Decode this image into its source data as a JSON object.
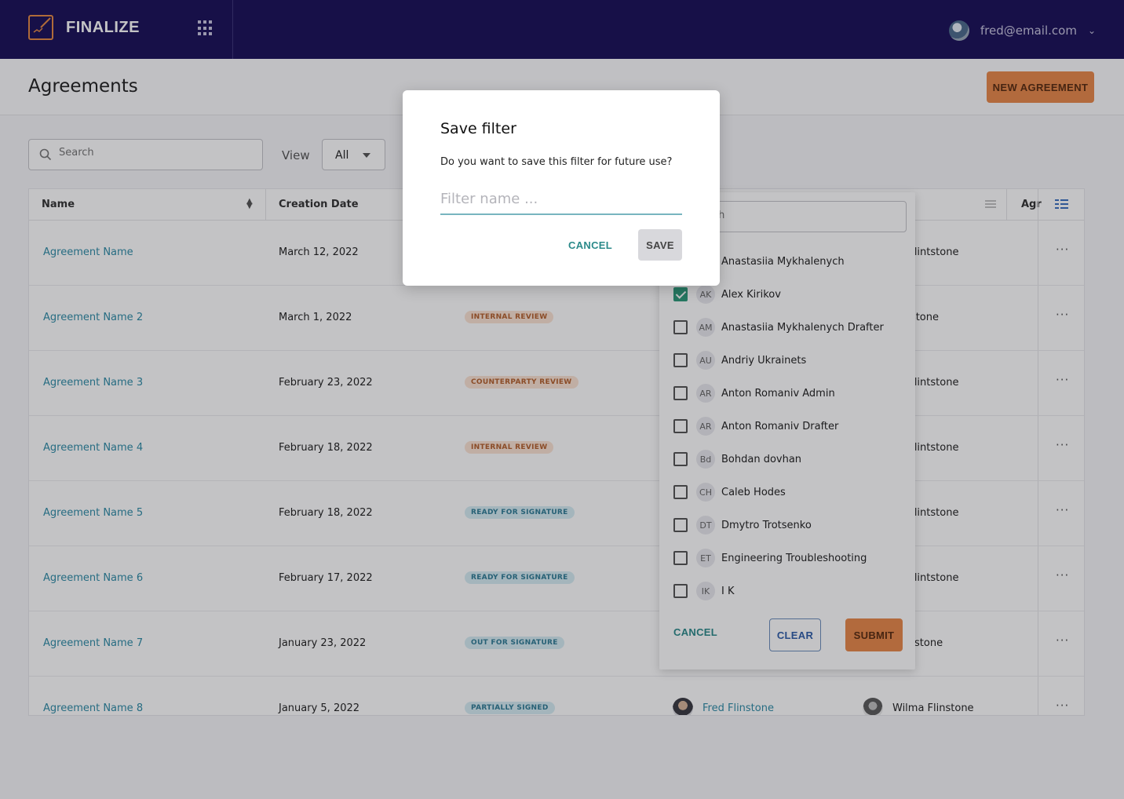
{
  "app": {
    "brand": "FINALIZE",
    "user_email": "fred@email.com"
  },
  "header": {
    "title": "Agreements",
    "new_button": "NEW AGREEMENT"
  },
  "toolbar": {
    "search_placeholder": "Search",
    "view_label": "View",
    "view_value": "All"
  },
  "table": {
    "columns": [
      "Name",
      "Creation Date",
      "Agr"
    ],
    "rows": [
      {
        "name": "Agreement Name",
        "date": "March 12, 2022",
        "status": "",
        "party2": "na Flintstone"
      },
      {
        "name": "Agreement Name 2",
        "date": "March 1, 2022",
        "status": "INTERNAL REVIEW",
        "party2": "Flinstone"
      },
      {
        "name": "Agreement Name 3",
        "date": "February 23, 2022",
        "status": "COUNTERPARTY REVIEW",
        "party2": "na Flintstone"
      },
      {
        "name": "Agreement Name 4",
        "date": "February 18, 2022",
        "status": "INTERNAL REVIEW",
        "party2": "na Flintstone"
      },
      {
        "name": "Agreement Name 5",
        "date": "February 18, 2022",
        "status": "READY FOR SIGNATURE",
        "party2": "na Flintstone"
      },
      {
        "name": "Agreement Name 6",
        "date": "February 17, 2022",
        "status": "READY FOR SIGNATURE",
        "party2": "na Flintstone"
      },
      {
        "name": "Agreement Name 7",
        "date": "January 23, 2022",
        "status": "OUT FOR SIGNATURE",
        "party2": "Flintstone"
      },
      {
        "name": "Agreement Name 8",
        "date": "January 5, 2022",
        "status": "PARTIALLY SIGNED",
        "owner": "Fred Flinstone",
        "party2": "Wilma Flinstone"
      }
    ],
    "more": "···"
  },
  "filter_panel": {
    "search_placeholder": "arch",
    "items": [
      {
        "initials": "",
        "name": "Anastasiia Mykhalenych",
        "checked": false
      },
      {
        "initials": "AK",
        "name": "Alex Kirikov",
        "checked": true
      },
      {
        "initials": "AM",
        "name": "Anastasiia Mykhalenych Drafter",
        "checked": false
      },
      {
        "initials": "AU",
        "name": "Andriy Ukrainets",
        "checked": false
      },
      {
        "initials": "AR",
        "name": "Anton Romaniv Admin",
        "checked": false
      },
      {
        "initials": "AR",
        "name": "Anton Romaniv Drafter",
        "checked": false
      },
      {
        "initials": "Bd",
        "name": "Bohdan dovhan",
        "checked": false
      },
      {
        "initials": "CH",
        "name": "Caleb Hodes",
        "checked": false
      },
      {
        "initials": "DT",
        "name": "Dmytro Trotsenko",
        "checked": false
      },
      {
        "initials": "ET",
        "name": "Engineering Troubleshooting",
        "checked": false
      },
      {
        "initials": "IK",
        "name": "I K",
        "checked": false
      }
    ],
    "cancel": "CANCEL",
    "clear": "CLEAR",
    "submit": "SUBMIT"
  },
  "modal": {
    "title": "Save filter",
    "text": "Do you want to save this filter for future use?",
    "placeholder": "Filter name ...",
    "cancel": "CANCEL",
    "save": "SAVE"
  },
  "colors": {
    "topbar": "#1a1158",
    "accent": "#e8884a",
    "link": "#2e8ba6",
    "teal": "#2b8a8a"
  }
}
